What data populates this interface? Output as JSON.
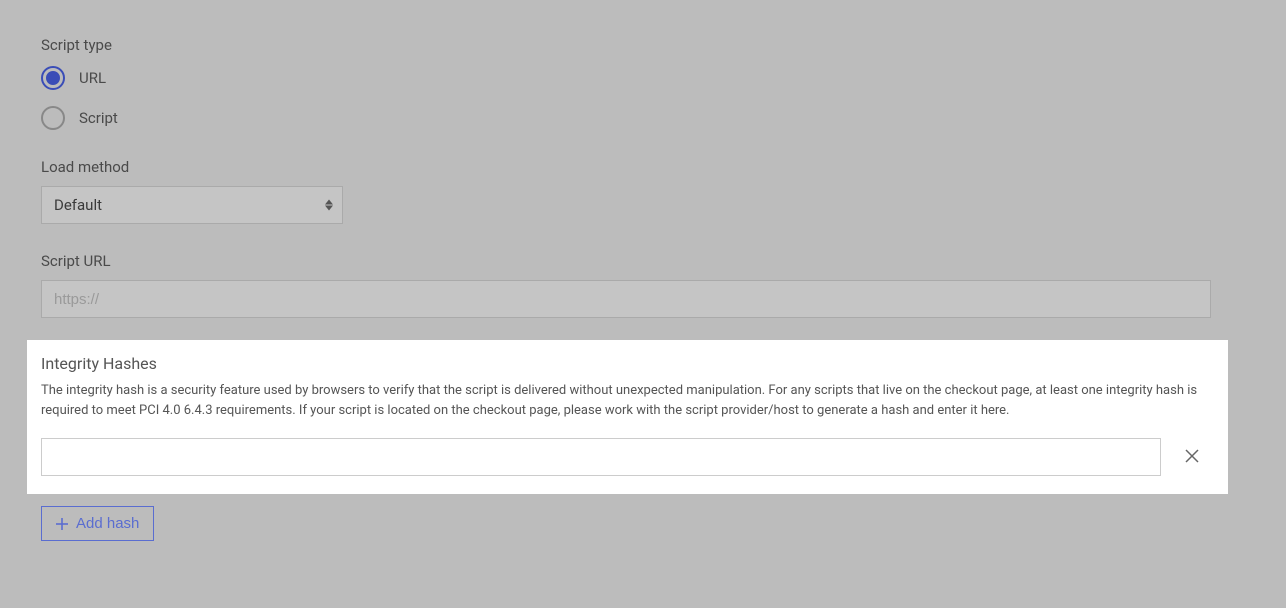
{
  "scriptType": {
    "label": "Script type",
    "options": [
      {
        "label": "URL",
        "checked": true
      },
      {
        "label": "Script",
        "checked": false
      }
    ]
  },
  "loadMethod": {
    "label": "Load method",
    "value": "Default"
  },
  "scriptUrl": {
    "label": "Script URL",
    "placeholder": "https://",
    "value": ""
  },
  "integrityHashes": {
    "title": "Integrity Hashes",
    "description": "The integrity hash is a security feature used by browsers to verify that the script is delivered without unexpected manipulation. For any scripts that live on the checkout page, at least one integrity hash is required to meet PCI 4.0 6.4.3 requirements. If your script is located on the checkout page, please work with the script provider/host to generate a hash and enter it here.",
    "rows": [
      {
        "value": ""
      }
    ],
    "addButtonLabel": "Add hash"
  }
}
